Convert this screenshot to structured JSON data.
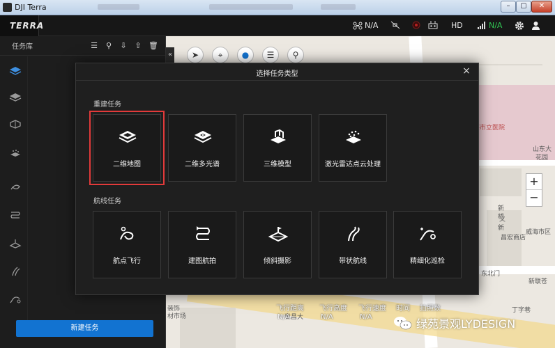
{
  "window": {
    "title": "DJI Terra",
    "minimize": "–",
    "maximize": "▢",
    "close": "✕"
  },
  "app": {
    "brand": "TERRA",
    "status": {
      "aircraft": "N/A",
      "hd": "HD",
      "signal": "N/A"
    },
    "accent": "#1273d1",
    "signal_color": "#31c653"
  },
  "left_panel": {
    "title": "任务库",
    "new_mission": "新建任务",
    "categories": [
      "2d-map-icon",
      "multispectral-icon",
      "3d-model-icon",
      "lidar-icon",
      "waypoint-icon",
      "mapping-icon",
      "oblique-icon",
      "corridor-icon",
      "inspection-icon"
    ]
  },
  "map": {
    "collapse": "«",
    "labels": {
      "hospital": "威海市立医院",
      "area1": "山东大",
      "area2": "花园",
      "xin": "新",
      "qiao": "桥",
      "xinyi": "新",
      "yi": "义",
      "changhong": "昌宏商店",
      "weihai": "威海市区",
      "dongbei": "东北门",
      "xinlian": "新联苍",
      "dingxiang": "丁字巷",
      "decor": "装饰",
      "market": "材市场",
      "shilu": "世昌大"
    },
    "zoom_in": "+",
    "zoom_out": "−",
    "flight_stats": [
      {
        "label": "飞行距离",
        "value": "N/A"
      },
      {
        "label": "飞行高度",
        "value": "N/A"
      },
      {
        "label": "飞行速度",
        "value": "N/A"
      },
      {
        "label": "时间",
        "value": ""
      },
      {
        "label": "拍照数",
        "value": ""
      }
    ]
  },
  "watermark": "绿苑景观LYDESIGN",
  "modal": {
    "title": "选择任务类型",
    "close": "×",
    "reconstruction_label": "重建任务",
    "reconstruction": [
      {
        "label": "二维地图",
        "icon": "2d-map-icon",
        "selected": true
      },
      {
        "label": "二维多光谱",
        "icon": "multispectral-icon"
      },
      {
        "label": "三维模型",
        "icon": "3d-model-icon"
      },
      {
        "label": "激光雷达点云处理",
        "icon": "lidar-icon"
      }
    ],
    "flight_label": "航线任务",
    "flight": [
      {
        "label": "航点飞行",
        "icon": "waypoint-icon"
      },
      {
        "label": "建图航拍",
        "icon": "mapping-icon"
      },
      {
        "label": "倾斜摄影",
        "icon": "oblique-icon"
      },
      {
        "label": "带状航线",
        "icon": "corridor-icon"
      },
      {
        "label": "精细化巡检",
        "icon": "inspection-icon"
      }
    ]
  }
}
